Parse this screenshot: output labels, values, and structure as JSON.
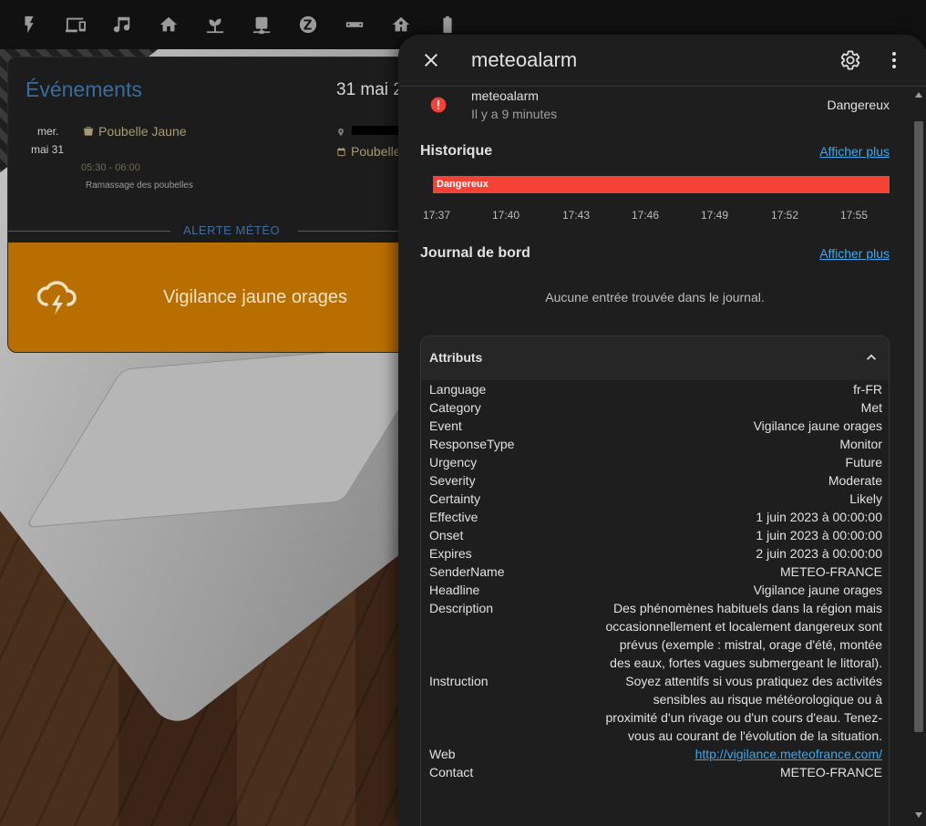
{
  "topbar": {
    "icons": [
      "lightning-icon",
      "devices-icon",
      "music-icon",
      "home-icon",
      "sprout-icon",
      "network-icon",
      "zwave-icon",
      "soundbar-icon",
      "home-flower-icon",
      "battery-icon"
    ]
  },
  "events_card": {
    "title": "Événements",
    "date": "31 mai 2",
    "event": {
      "day": "mer.",
      "date": "mai 31",
      "name": "Poubelle Jaune",
      "time": "05:30 - 06:00",
      "description": "Ramassage des poubelles",
      "calendar": "Poubelle"
    },
    "divider_label": "ALERTE MÉTÉO",
    "alert": {
      "text": "Vigilance jaune orages",
      "color": "#b96f00"
    }
  },
  "dialog": {
    "title": "meteoalarm",
    "state": {
      "name": "meteoalarm",
      "time_ago": "Il y a 9 minutes",
      "value": "Dangereux",
      "color": "#f44336"
    },
    "history": {
      "title": "Historique",
      "show_more": "Afficher plus",
      "bar_label": "Dangereux",
      "ticks": [
        "17:37",
        "17:40",
        "17:43",
        "17:46",
        "17:49",
        "17:52",
        "17:55"
      ]
    },
    "logbook": {
      "title": "Journal de bord",
      "show_more": "Afficher plus",
      "empty": "Aucune entrée trouvée dans le journal."
    },
    "attributes": {
      "title": "Attributs",
      "rows": [
        {
          "key": "Language",
          "value": "fr-FR"
        },
        {
          "key": "Category",
          "value": "Met"
        },
        {
          "key": "Event",
          "value": "Vigilance jaune orages"
        },
        {
          "key": "ResponseType",
          "value": "Monitor"
        },
        {
          "key": "Urgency",
          "value": "Future"
        },
        {
          "key": "Severity",
          "value": "Moderate"
        },
        {
          "key": "Certainty",
          "value": "Likely"
        },
        {
          "key": "Effective",
          "value": "1 juin 2023 à 00:00:00"
        },
        {
          "key": "Onset",
          "value": "1 juin 2023 à 00:00:00"
        },
        {
          "key": "Expires",
          "value": "2 juin 2023 à 00:00:00"
        },
        {
          "key": "SenderName",
          "value": "METEO-FRANCE"
        },
        {
          "key": "Headline",
          "value": "Vigilance jaune orages"
        },
        {
          "key": "Description",
          "value": "Des phénomènes habituels dans la région mais occasionnellement et localement dangereux sont prévus (exemple : mistral, orage d'été, montée des eaux, fortes vagues submergeant le littoral)."
        },
        {
          "key": "Instruction",
          "value": "Soyez attentifs si vous pratiquez des activités sensibles au risque météorologique ou à proximité d'un rivage ou d'un cours d'eau. Tenez-vous au courant de l'évolution de la situation."
        },
        {
          "key": "Web",
          "value": "http://vigilance.meteofrance.com/",
          "link": true
        },
        {
          "key": "Contact",
          "value": "METEO-FRANCE"
        }
      ]
    }
  }
}
